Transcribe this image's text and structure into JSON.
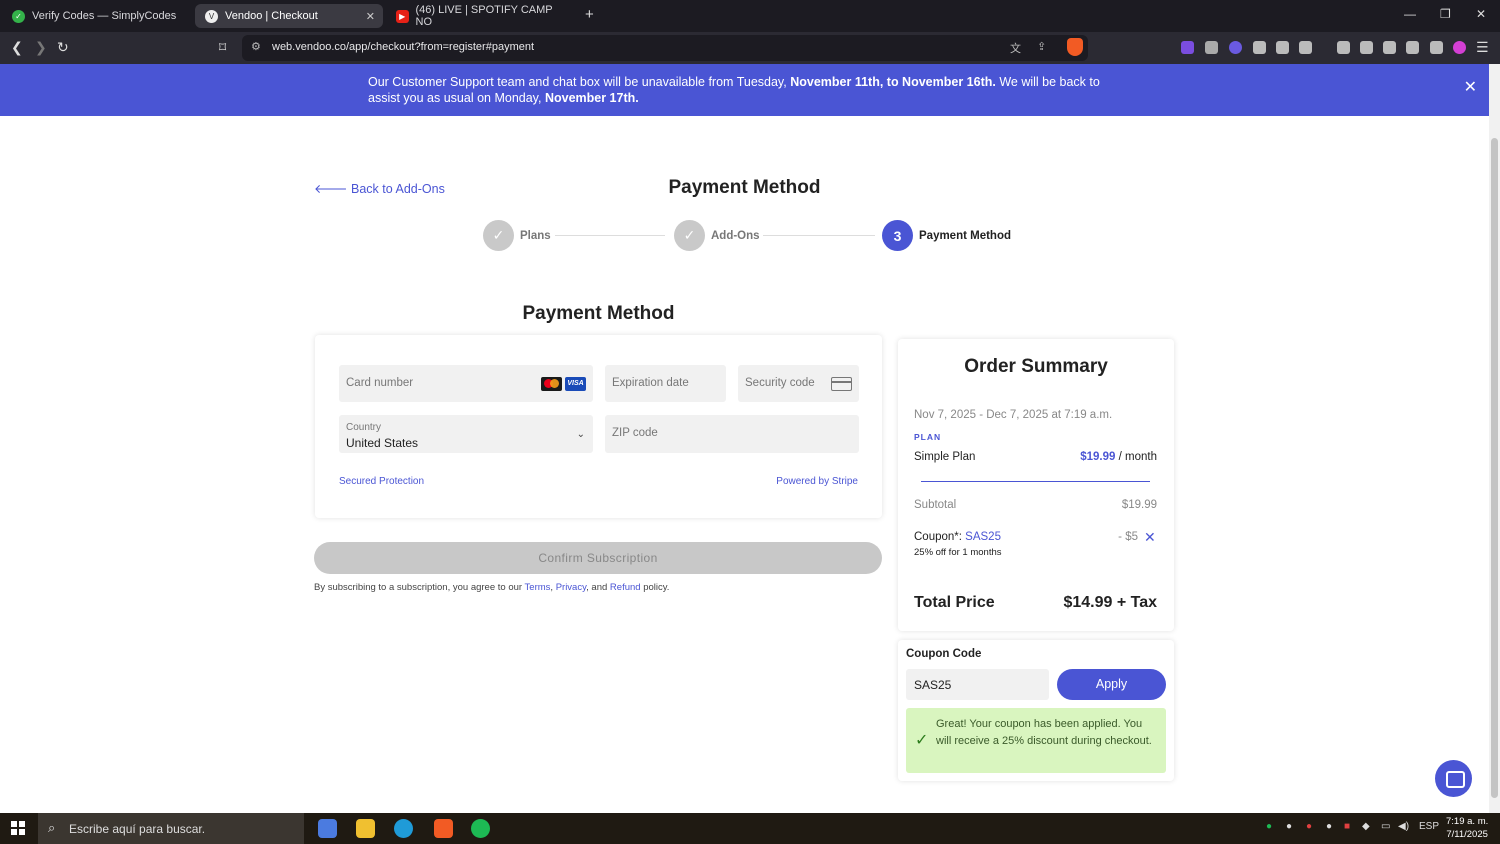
{
  "browser": {
    "tabs": [
      {
        "title": "Verify Codes — SimplyCodes"
      },
      {
        "title": "Vendoo | Checkout"
      },
      {
        "title": "(46)  LIVE | SPOTIFY CAMP NO"
      }
    ],
    "url": "web.vendoo.co/app/checkout?from=register#payment"
  },
  "banner": {
    "part1": "Our Customer Support team and chat box will be unavailable from Tuesday, ",
    "bold1": "November 11th, to November 16th.",
    "part2": " We will be back to assist you as usual on Monday, ",
    "bold2": "November 17th."
  },
  "brand": {
    "name": "VENDOO"
  },
  "page": {
    "back_link": "Back to Add-Ons",
    "title": "Payment Method"
  },
  "steps": [
    {
      "label": "Plans",
      "state": "done"
    },
    {
      "label": "Add-Ons",
      "state": "done"
    },
    {
      "label": "Payment Method",
      "number": "3",
      "state": "active"
    }
  ],
  "payment": {
    "title": "Payment Method",
    "card_number_placeholder": "Card number",
    "expiration_placeholder": "Expiration date",
    "security_placeholder": "Security code",
    "country_label": "Country",
    "country_value": "United States",
    "zip_placeholder": "ZIP code",
    "secured": "Secured Protection",
    "powered": "Powered by Stripe",
    "visa_label": "VISA"
  },
  "confirm_label": "Confirm Subscription",
  "terms": {
    "prefix": "By subscribing to a subscription, you agree to our ",
    "terms": "Terms",
    "sep1": ", ",
    "privacy": "Privacy",
    "sep2": ", and ",
    "refund": "Refund",
    "suffix": " policy."
  },
  "order_summary": {
    "title": "Order Summary",
    "dates": "Nov 7, 2025 - Dec 7, 2025 at 7:19 a.m.",
    "plan_tag": "PLAN",
    "plan_name": "Simple Plan",
    "plan_price": "$19.99",
    "plan_period": " / month",
    "subtotal_label": "Subtotal",
    "subtotal_value": "$19.99",
    "coupon_label": "Coupon*: ",
    "coupon_code": "SAS25",
    "coupon_desc": "25% off for 1 months",
    "coupon_discount": "- $5",
    "total_label": "Total Price",
    "total_value": "$14.99 + Tax"
  },
  "coupon_box": {
    "title": "Coupon Code",
    "input_value": "SAS25",
    "apply_label": "Apply",
    "success_message": "Great! Your coupon has been applied. You will receive a 25% discount during checkout."
  },
  "taskbar": {
    "search_text": "Escribe aquí para buscar.",
    "lang": "ESP",
    "time": "7:19 a. m.",
    "date": "7/11/2025"
  },
  "colors": {
    "accent": "#4a55d4",
    "success_bg": "#d9f5bf",
    "disabled": "#c8c8c8"
  }
}
